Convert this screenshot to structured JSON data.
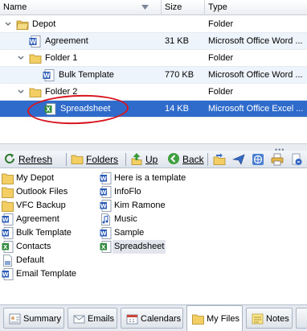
{
  "columns": {
    "name": "Name",
    "size": "Size",
    "type": "Type"
  },
  "tree_rows": [
    {
      "name": "Depot",
      "size": "",
      "type": "Folder",
      "icon": "folder-open-icon"
    },
    {
      "name": "Agreement",
      "size": "31 KB",
      "type": "Microsoft Office Word ...",
      "icon": "word-document-icon"
    },
    {
      "name": "Folder 1",
      "size": "",
      "type": "Folder",
      "icon": "folder-icon"
    },
    {
      "name": "Bulk Template",
      "size": "770 KB",
      "type": "Microsoft Office Word ...",
      "icon": "word-document-icon"
    },
    {
      "name": "Folder 2",
      "size": "",
      "type": "Folder",
      "icon": "folder-icon"
    },
    {
      "name": "Spreadsheet",
      "size": "14 KB",
      "type": "Microsoft Office Excel ...",
      "icon": "excel-document-icon",
      "selected": true
    }
  ],
  "toolbar": {
    "refresh": "Refresh",
    "folders": "Folders",
    "up": "Up",
    "back": "Back",
    "icons": [
      "move-to-folder-icon",
      "send-icon",
      "globe-icon",
      "print-icon",
      "properties-icon"
    ]
  },
  "files": {
    "left": [
      {
        "label": "My Depot",
        "icon": "folder-icon"
      },
      {
        "label": "Outlook Files",
        "icon": "folder-icon"
      },
      {
        "label": "VFC Backup",
        "icon": "folder-icon"
      },
      {
        "label": "Agreement",
        "icon": "word-document-icon"
      },
      {
        "label": "Bulk Template",
        "icon": "word-document-icon"
      },
      {
        "label": "Contacts",
        "icon": "excel-document-icon"
      },
      {
        "label": "Default",
        "icon": "generic-document-icon"
      },
      {
        "label": "Email Template",
        "icon": "word-document-icon"
      }
    ],
    "right": [
      {
        "label": "Here is a template",
        "icon": "word-document-icon"
      },
      {
        "label": "InfoFlo",
        "icon": "word-document-icon"
      },
      {
        "label": "Kim Ramone",
        "icon": "word-document-icon"
      },
      {
        "label": "Music",
        "icon": "music-file-icon"
      },
      {
        "label": "Sample",
        "icon": "word-document-icon"
      },
      {
        "label": "Spreadsheet",
        "icon": "excel-document-icon",
        "selected": true
      }
    ]
  },
  "tabs": [
    {
      "label": "Summary",
      "icon": "summary-icon"
    },
    {
      "label": "Emails",
      "icon": "email-icon"
    },
    {
      "label": "Calendars",
      "icon": "calendar-icon"
    },
    {
      "label": "My Files",
      "icon": "folder-icon",
      "active": true
    },
    {
      "label": "Notes",
      "icon": "notes-icon"
    }
  ],
  "colors": {
    "selection": "#2f6bcb",
    "annotation_ellipse": "#d8141e",
    "alt_row": "#eef4fb"
  }
}
